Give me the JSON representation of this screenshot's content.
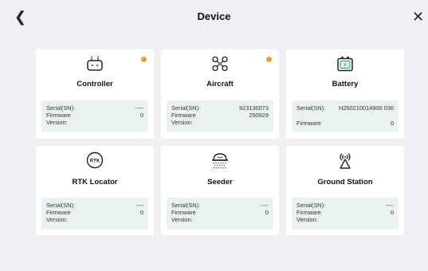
{
  "header": {
    "title": "Device",
    "back_icon": "chevron-left-icon",
    "close_icon": "close-icon"
  },
  "colors": {
    "accent": "#2ba37a",
    "status_dot": "#f29a37",
    "info_bg": "#eaf2ee"
  },
  "devices": [
    {
      "name": "Controller",
      "icon": "controller-icon",
      "status_dot": true,
      "serial_label": "Serial(SN):",
      "serial_value": "----",
      "firmware_label_1": "Firmware",
      "firmware_label_2": "Version:",
      "firmware_value": "0"
    },
    {
      "name": "Aircraft",
      "icon": "drone-icon",
      "status_dot": true,
      "serial_label": "Serial(SN):",
      "serial_value": "923130073",
      "firmware_label_1": "Firmware",
      "firmware_label_2": "Version:",
      "firmware_value": "250929"
    },
    {
      "name": "Battery",
      "icon": "battery-icon",
      "status_dot": false,
      "serial_label": "Serial(SN):",
      "serial_value": "H250210014900 036",
      "firmware_label_1": "Firmware",
      "firmware_label_2": "",
      "firmware_value": "0"
    },
    {
      "name": "RTK Locator",
      "icon": "rtk-icon",
      "status_dot": false,
      "serial_label": "Serial(SN):",
      "serial_value": "----",
      "firmware_label_1": "Firmware",
      "firmware_label_2": "Version:",
      "firmware_value": "0"
    },
    {
      "name": "Seeder",
      "icon": "seeder-icon",
      "status_dot": false,
      "serial_label": "Serial(SN):",
      "serial_value": "----",
      "firmware_label_1": "Firmware",
      "firmware_label_2": "Version:",
      "firmware_value": "0"
    },
    {
      "name": "Ground Station",
      "icon": "ground-station-icon",
      "status_dot": false,
      "serial_label": "Serial(SN):",
      "serial_value": "----",
      "firmware_label_1": "Firmware",
      "firmware_label_2": "Version:",
      "firmware_value": "0"
    }
  ]
}
